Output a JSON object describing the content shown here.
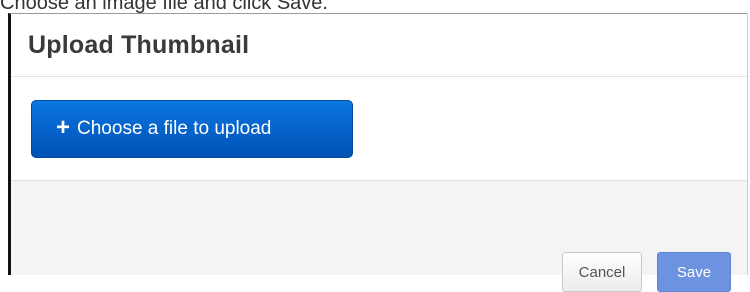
{
  "instruction": "Choose an image file and click Save.",
  "dialog": {
    "title": "Upload Thumbnail",
    "upload_button": {
      "label": "Choose a file to upload",
      "icon": "plus-icon",
      "icon_glyph": "+"
    },
    "footer": {
      "cancel_label": "Cancel",
      "save_label": "Save"
    }
  },
  "colors": {
    "upload_button_bg": "#0561c9",
    "save_button_bg": "#6d92e0",
    "footer_bg": "#f4f4f4"
  }
}
